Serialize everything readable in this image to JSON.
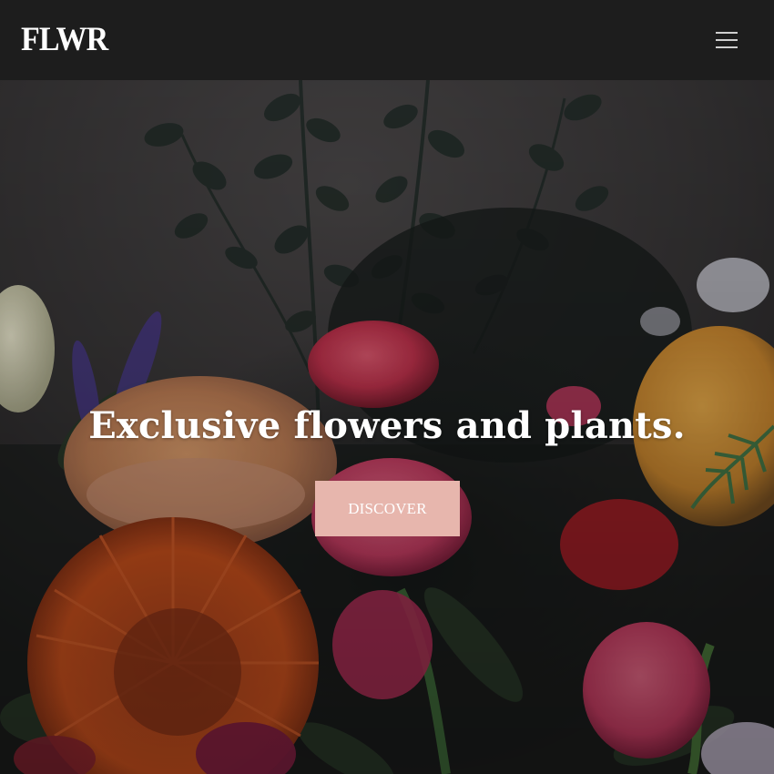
{
  "header": {
    "logo_text": "FLWR",
    "menu_icon": "hamburger-menu-icon"
  },
  "hero": {
    "title": "Exclusive flowers and plants.",
    "cta_label": "DISCOVER",
    "background_image": "flower-bouquet-photo"
  },
  "colors": {
    "header_bg": "#1d1d1d",
    "logo": "#ffffff",
    "menu_icon": "#cfcfcf",
    "cta_bg": "#e7b6ad",
    "cta_text": "#ffffff",
    "title": "#ffffff"
  }
}
